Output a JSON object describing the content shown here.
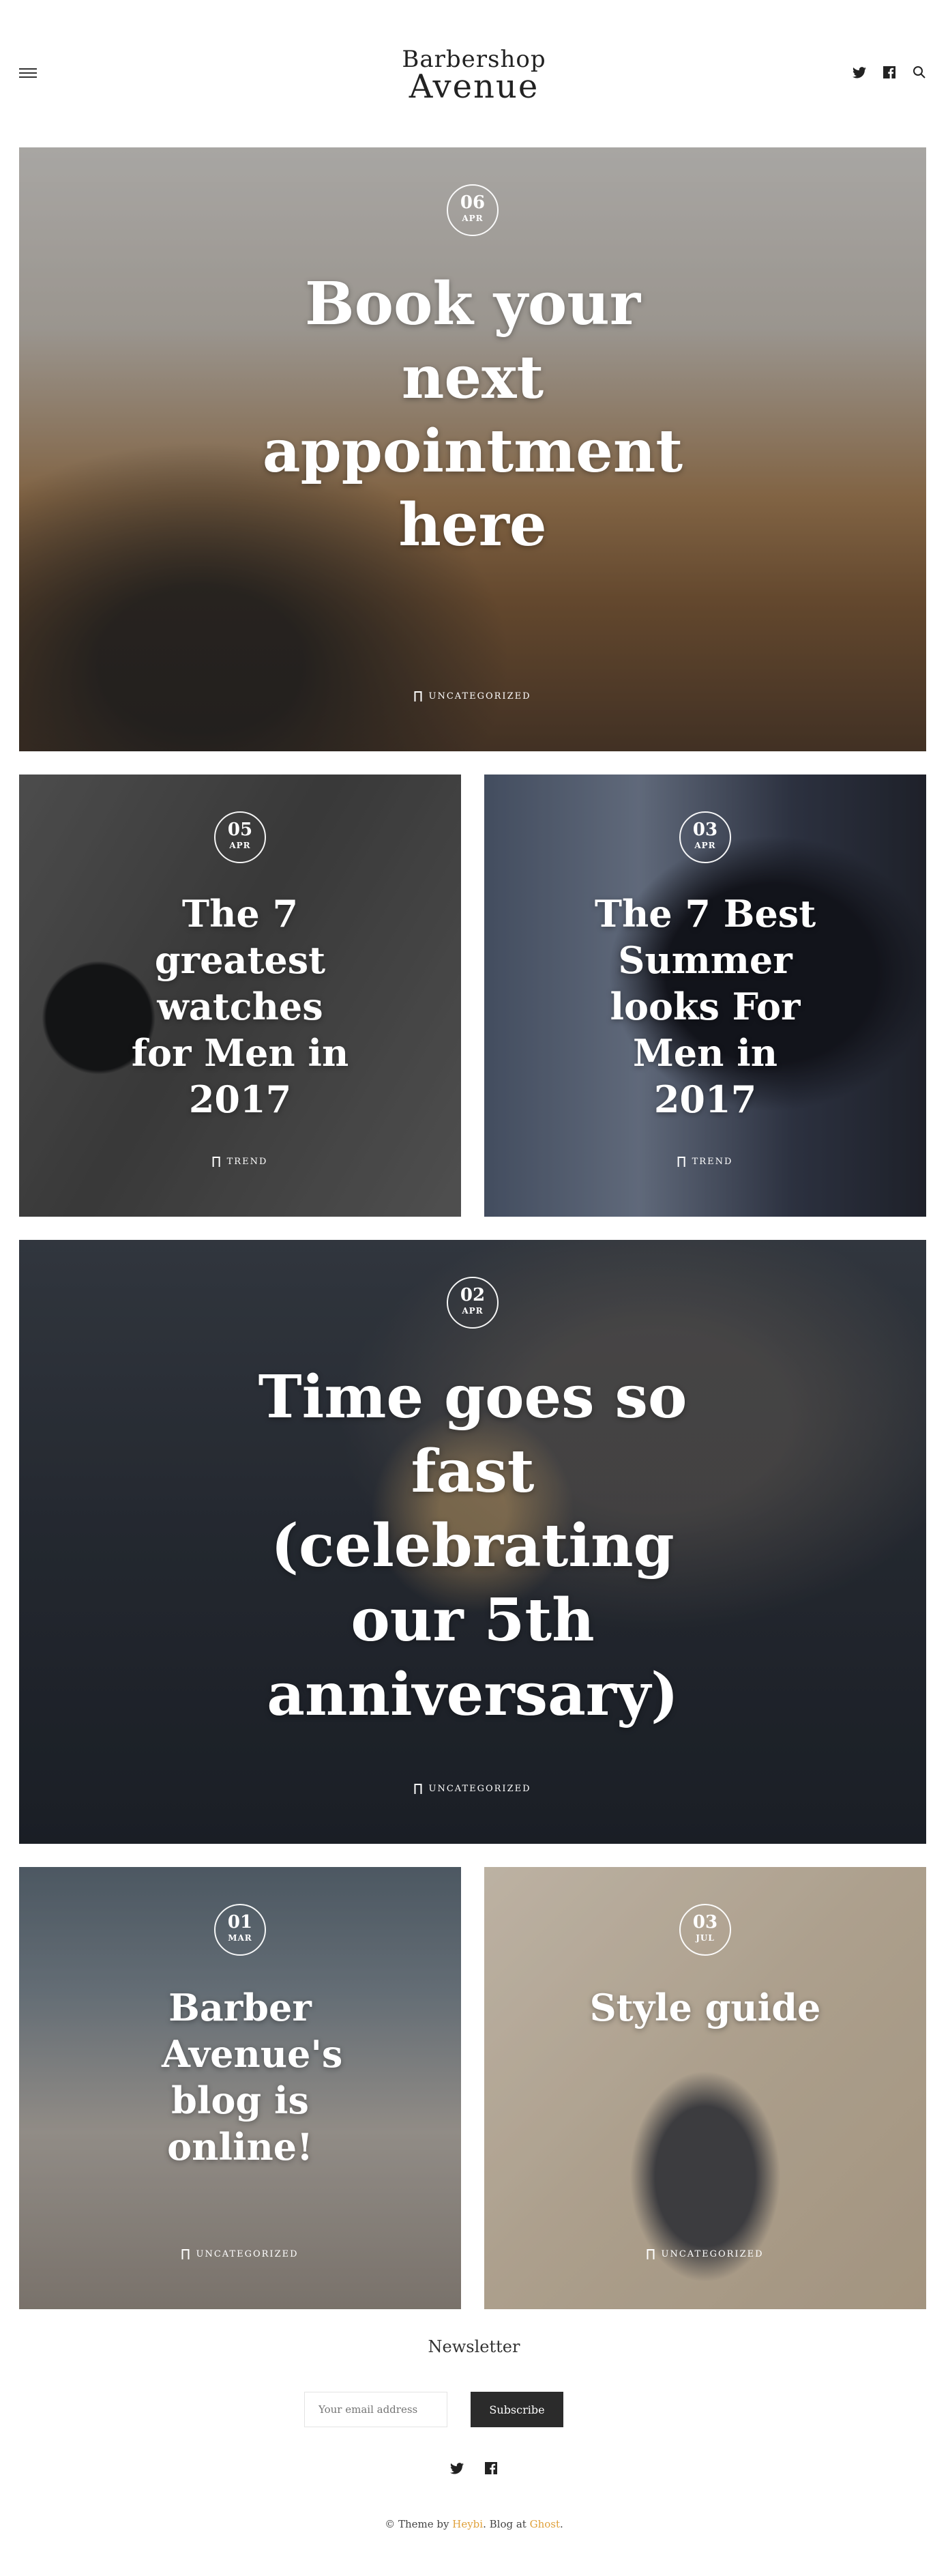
{
  "header": {
    "logo_line1": "Barbershop",
    "logo_line2": "Avenue"
  },
  "posts": [
    {
      "day": "06",
      "month": "APR",
      "title": "Book your next appointment here",
      "tag": "UNCATEGORIZED"
    },
    {
      "day": "05",
      "month": "APR",
      "title": "The 7 greatest watches for Men in 2017",
      "tag": "TREND"
    },
    {
      "day": "03",
      "month": "APR",
      "title": "The 7 Best Summer looks For Men in 2017",
      "tag": "TREND"
    },
    {
      "day": "02",
      "month": "APR",
      "title": "Time goes so fast (celebrating our 5th anniversary)",
      "tag": "UNCATEGORIZED"
    },
    {
      "day": "01",
      "month": "MAR",
      "title": "Barber Avenue's blog is online!",
      "tag": "UNCATEGORIZED"
    },
    {
      "day": "03",
      "month": "JUL",
      "title": "Style guide",
      "tag": "UNCATEGORIZED"
    }
  ],
  "newsletter": {
    "heading": "Newsletter",
    "placeholder": "Your email address",
    "button": "Subscribe"
  },
  "footer": {
    "prefix": "© Theme by ",
    "author": "Heybi",
    "middle": ". Blog at ",
    "platform": "Ghost",
    "suffix": "."
  },
  "colors": {
    "accent": "#e0a13a",
    "button": "#2b2b2b"
  }
}
